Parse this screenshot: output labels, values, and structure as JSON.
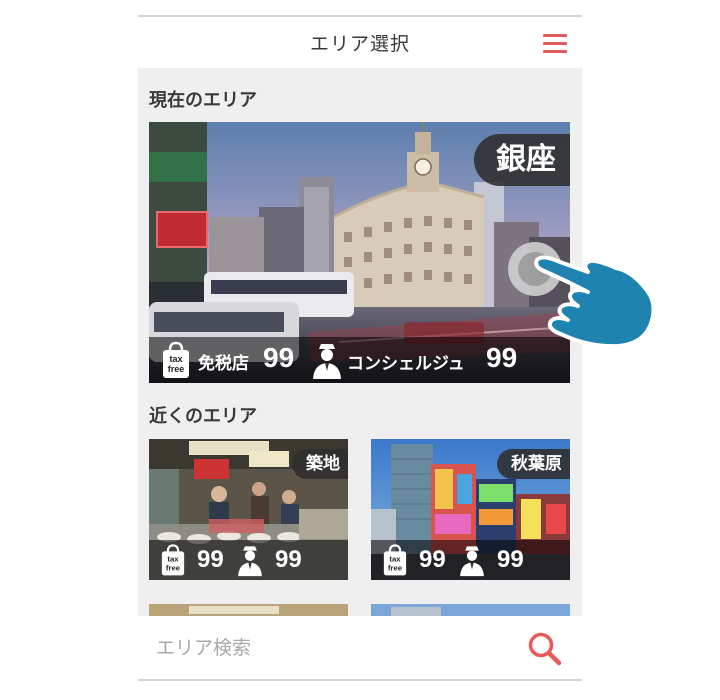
{
  "header": {
    "title": "エリア選択"
  },
  "current_section": {
    "title": "現在のエリア"
  },
  "current_area": {
    "name": "銀座",
    "tax_free_label": "免税店",
    "tax_free_count": "99",
    "concierge_label": "コンシェルジュ",
    "concierge_count": "99"
  },
  "nearby_section": {
    "title": "近くのエリア"
  },
  "nearby_areas": [
    {
      "name": "築地",
      "tax_free_count": "99",
      "concierge_count": "99"
    },
    {
      "name": "秋葉原",
      "tax_free_count": "99",
      "concierge_count": "99"
    }
  ],
  "tax_icon_text": {
    "line1": "tax",
    "line2": "free"
  },
  "search": {
    "placeholder": "エリア検索"
  },
  "colors": {
    "accent": "#e85a5a",
    "background": "#efefef",
    "hand": "#1f83b2"
  }
}
